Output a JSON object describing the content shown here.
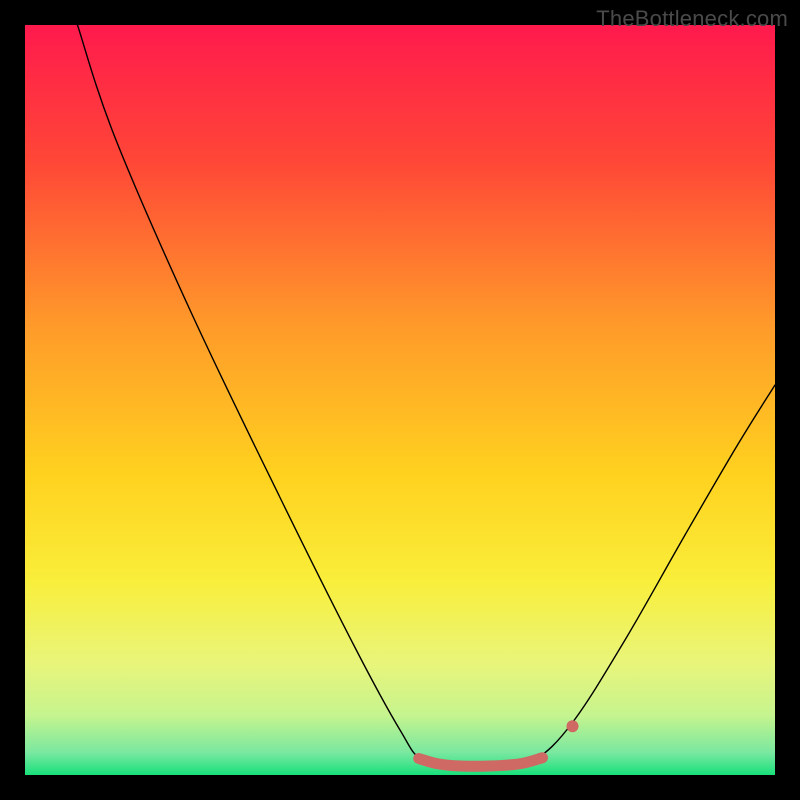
{
  "attribution": "TheBottleneck.com",
  "chart_data": {
    "type": "line",
    "title": "",
    "xlabel": "",
    "ylabel": "",
    "xlim": [
      0,
      100
    ],
    "ylim": [
      0,
      100
    ],
    "grid": false,
    "legend": false,
    "background_gradient": {
      "direction": "vertical",
      "stops": [
        {
          "pct": 0,
          "color": "#ff1a4d"
        },
        {
          "pct": 18,
          "color": "#ff4637"
        },
        {
          "pct": 40,
          "color": "#ff9a2a"
        },
        {
          "pct": 60,
          "color": "#ffd21f"
        },
        {
          "pct": 74,
          "color": "#f9ee3a"
        },
        {
          "pct": 85,
          "color": "#e9f57a"
        },
        {
          "pct": 92,
          "color": "#c6f48e"
        },
        {
          "pct": 97,
          "color": "#7ae8a0"
        },
        {
          "pct": 100,
          "color": "#18e07b"
        }
      ]
    },
    "series": [
      {
        "name": "bottleneck-curve",
        "stroke": "#000000",
        "stroke_width": 1.4,
        "points": [
          {
            "x": 7,
            "y": 100
          },
          {
            "x": 12,
            "y": 85
          },
          {
            "x": 22,
            "y": 62
          },
          {
            "x": 34,
            "y": 37
          },
          {
            "x": 44,
            "y": 17
          },
          {
            "x": 50,
            "y": 6
          },
          {
            "x": 53,
            "y": 2
          },
          {
            "x": 58,
            "y": 1
          },
          {
            "x": 64,
            "y": 1
          },
          {
            "x": 68,
            "y": 2
          },
          {
            "x": 73,
            "y": 7
          },
          {
            "x": 80,
            "y": 18
          },
          {
            "x": 88,
            "y": 32
          },
          {
            "x": 95,
            "y": 44
          },
          {
            "x": 100,
            "y": 52
          }
        ]
      },
      {
        "name": "flat-bottom-marker",
        "stroke": "#cf6964",
        "stroke_width": 11,
        "linecap": "round",
        "points": [
          {
            "x": 52.5,
            "y": 2.2
          },
          {
            "x": 55,
            "y": 1.5
          },
          {
            "x": 58,
            "y": 1.2
          },
          {
            "x": 62,
            "y": 1.2
          },
          {
            "x": 66,
            "y": 1.5
          },
          {
            "x": 69,
            "y": 2.3
          }
        ]
      }
    ],
    "markers": [
      {
        "name": "right-shoulder-dot",
        "x": 73,
        "y": 6.5,
        "r": 6,
        "fill": "#cf6964"
      }
    ]
  }
}
